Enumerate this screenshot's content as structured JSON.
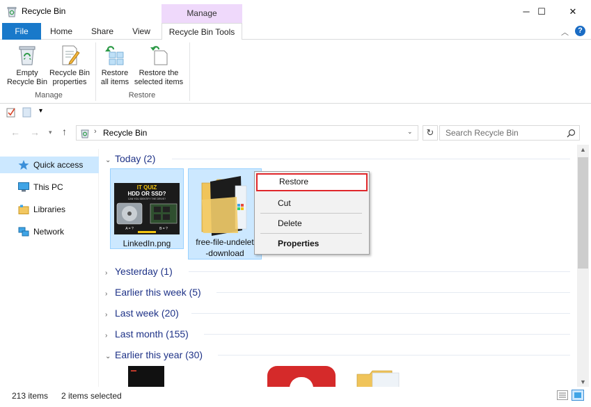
{
  "window": {
    "title": "Recycle Bin",
    "context_tab_group": "Manage",
    "minimize": "─",
    "maximize": "☐",
    "close": "✕"
  },
  "ribbon": {
    "tabs": [
      "File",
      "Home",
      "Share",
      "View",
      "Recycle Bin Tools"
    ],
    "manage_group": {
      "empty_line1": "Empty",
      "empty_line2": "Recycle Bin",
      "props_line1": "Recycle Bin",
      "props_line2": "properties",
      "label": "Manage"
    },
    "restore_group": {
      "all_line1": "Restore",
      "all_line2": "all items",
      "sel_line1": "Restore the",
      "sel_line2": "selected items",
      "label": "Restore"
    }
  },
  "address": {
    "path": "Recycle Bin",
    "search_placeholder": "Search Recycle Bin"
  },
  "nav": {
    "items": [
      "Quick access",
      "This PC",
      "Libraries",
      "Network"
    ]
  },
  "groups": [
    "Today (2)",
    "Yesterday (1)",
    "Earlier this week (5)",
    "Last week (20)",
    "Last month (155)",
    "Earlier this year (30)"
  ],
  "files": {
    "linkedin": "LinkedIn.png",
    "undelete_line1": "free-file-undelet",
    "undelete_line2": "-download",
    "thumb": {
      "line1": "IT QUIZ",
      "line2": "HDD OR SSD?",
      "line3": "CAN YOU IDENTIFY THE DRIVE?",
      "a": "A = ?",
      "b": "B = ?"
    }
  },
  "context_menu": {
    "restore": "Restore",
    "cut": "Cut",
    "delete": "Delete",
    "properties": "Properties"
  },
  "status": {
    "count": "213 items",
    "selected": "2 items selected"
  },
  "colors": {
    "accent": "#1979ca",
    "context_tab": "#efd9fb",
    "selection": "#cce8ff",
    "highlight_border": "#e0272b",
    "group_header": "#1e3287"
  }
}
